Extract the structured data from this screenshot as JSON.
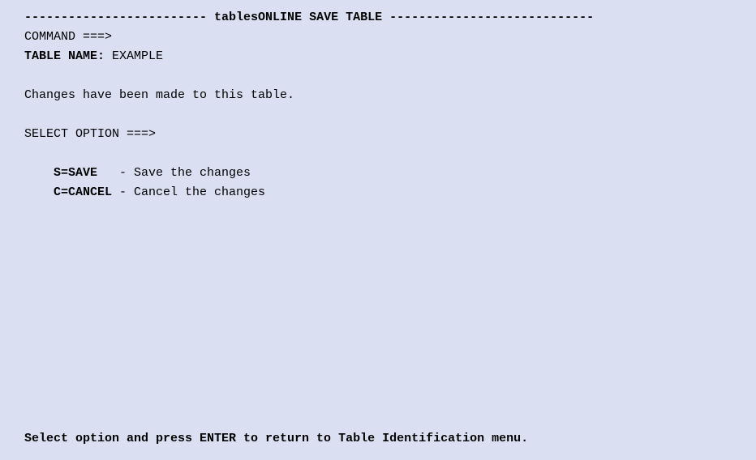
{
  "header": {
    "dashes_left": "------------------------- ",
    "title": "tablesONLINE SAVE TABLE",
    "dashes_right": " ----------------------------"
  },
  "command": {
    "label": "COMMAND ===>",
    "value": ""
  },
  "table_name": {
    "label": "TABLE NAME:",
    "value": " EXAMPLE"
  },
  "message": "Changes have been made to this table.",
  "select_option": {
    "label": "SELECT OPTION ===>",
    "value": ""
  },
  "options": [
    {
      "key": "S=SAVE  ",
      "desc": " - Save the changes"
    },
    {
      "key": "C=CANCEL",
      "desc": " - Cancel the changes"
    }
  ],
  "footer": "Select option and press ENTER to return to Table Identification menu."
}
